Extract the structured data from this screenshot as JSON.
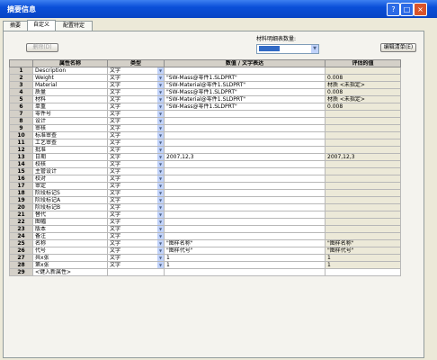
{
  "window": {
    "title": "摘要信息",
    "help_label": "?",
    "max_label": "□",
    "close_label": "×"
  },
  "tabs": [
    {
      "label": "摘要"
    },
    {
      "label": "自定义"
    },
    {
      "label": "配置特定"
    }
  ],
  "toolbar": {
    "delete_label": "删除(D)",
    "bom_label": "材料明细表数量:",
    "bom_value": "",
    "edit_list_label": "编辑清单(E)"
  },
  "table": {
    "headers": [
      "",
      "属性名称",
      "类型",
      "数值 / 文字表达",
      "评估的值"
    ],
    "rows": [
      {
        "num": "1",
        "name": "Description",
        "type": "文字",
        "value": "",
        "evaluated": ""
      },
      {
        "num": "2",
        "name": "Weight",
        "type": "文字",
        "value": "\"SW-Mass@零件1.SLDPRT\"",
        "evaluated": "0.008"
      },
      {
        "num": "3",
        "name": "Material",
        "type": "文字",
        "value": "\"SW-Material@零件1.SLDPRT\"",
        "evaluated": "材质 <未指定>"
      },
      {
        "num": "4",
        "name": "质量",
        "type": "文字",
        "value": "\"SW-Mass@零件1.SLDPRT\"",
        "evaluated": "0.008"
      },
      {
        "num": "5",
        "name": "材料",
        "type": "文字",
        "value": "\"SW-Material@零件1.SLDPRT\"",
        "evaluated": "材质 <未指定>"
      },
      {
        "num": "6",
        "name": "单重",
        "type": "文字",
        "value": "\"SW-Mass@零件1.SLDPRT\"",
        "evaluated": "0.008"
      },
      {
        "num": "7",
        "name": "零件号",
        "type": "文字",
        "value": "",
        "evaluated": ""
      },
      {
        "num": "8",
        "name": "设计",
        "type": "文字",
        "value": "",
        "evaluated": ""
      },
      {
        "num": "9",
        "name": "审核",
        "type": "文字",
        "value": "",
        "evaluated": ""
      },
      {
        "num": "10",
        "name": "标准审查",
        "type": "文字",
        "value": "",
        "evaluated": ""
      },
      {
        "num": "11",
        "name": "工艺审查",
        "type": "文字",
        "value": "",
        "evaluated": ""
      },
      {
        "num": "12",
        "name": "批准",
        "type": "文字",
        "value": "",
        "evaluated": ""
      },
      {
        "num": "13",
        "name": "日期",
        "type": "文字",
        "value": "2007,12,3",
        "evaluated": "2007,12,3"
      },
      {
        "num": "14",
        "name": "校核",
        "type": "文字",
        "value": "",
        "evaluated": ""
      },
      {
        "num": "15",
        "name": "主管设计",
        "type": "文字",
        "value": "",
        "evaluated": ""
      },
      {
        "num": "16",
        "name": "校对",
        "type": "文字",
        "value": "",
        "evaluated": ""
      },
      {
        "num": "17",
        "name": "审定",
        "type": "文字",
        "value": "",
        "evaluated": ""
      },
      {
        "num": "18",
        "name": "阶段标记S",
        "type": "文字",
        "value": "",
        "evaluated": ""
      },
      {
        "num": "19",
        "name": "阶段标记A",
        "type": "文字",
        "value": "",
        "evaluated": ""
      },
      {
        "num": "20",
        "name": "阶段标记B",
        "type": "文字",
        "value": "",
        "evaluated": ""
      },
      {
        "num": "21",
        "name": "替代",
        "type": "文字",
        "value": "",
        "evaluated": ""
      },
      {
        "num": "22",
        "name": "图幅",
        "type": "文字",
        "value": "",
        "evaluated": ""
      },
      {
        "num": "23",
        "name": "版本",
        "type": "文字",
        "value": "",
        "evaluated": ""
      },
      {
        "num": "24",
        "name": "备注",
        "type": "文字",
        "value": "",
        "evaluated": ""
      },
      {
        "num": "25",
        "name": "名称",
        "type": "文字",
        "value": "\"图样名称\"",
        "evaluated": "\"图样名称\""
      },
      {
        "num": "26",
        "name": "代号",
        "type": "文字",
        "value": "\"图样代号\"",
        "evaluated": "\"图样代号\""
      },
      {
        "num": "27",
        "name": "共x张",
        "type": "文字",
        "value": "1",
        "evaluated": "1"
      },
      {
        "num": "28",
        "name": "第x张",
        "type": "文字",
        "value": "1",
        "evaluated": "1"
      },
      {
        "num": "29",
        "name": "<键入新属性>",
        "type": "",
        "value": "",
        "evaluated": ""
      }
    ]
  }
}
